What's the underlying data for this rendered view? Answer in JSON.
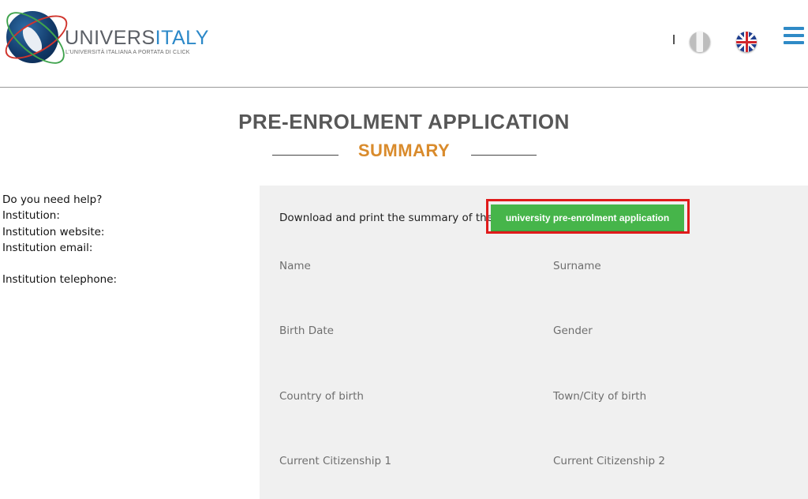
{
  "header": {
    "brand_part1": "UNIVERS",
    "brand_part2": "ITALY",
    "tagline": "L'UNIVERSITÀ ITALIANA A PORTATA DI CLICK",
    "separator": "|",
    "icons": [
      "globe-logo-icon",
      "italian-flag-icon",
      "uk-flag-icon",
      "hamburger-menu-icon"
    ]
  },
  "page": {
    "title": "PRE-ENROLMENT APPLICATION",
    "subtitle": "SUMMARY"
  },
  "help": {
    "question": "Do you need help?",
    "institution": "Institution:",
    "website": "Institution website:",
    "email": "Institution email:",
    "telephone": "Institution telephone:"
  },
  "summary": {
    "download_text": "Download and print the summary of the",
    "download_button": "university pre-enrolment application",
    "fields": {
      "name": "Name",
      "surname": "Surname",
      "birth_date": "Birth Date",
      "gender": "Gender",
      "country_of_birth": "Country of birth",
      "town_of_birth": "Town/City of birth",
      "citizenship1": "Current Citizenship 1",
      "citizenship2": "Current Citizenship 2"
    }
  },
  "colors": {
    "brand_blue": "#2b88c8",
    "subtitle_orange": "#d98b2c",
    "button_green": "#46b54a",
    "highlight_red": "#e01b1b",
    "panel_gray": "#f0f0f0"
  }
}
